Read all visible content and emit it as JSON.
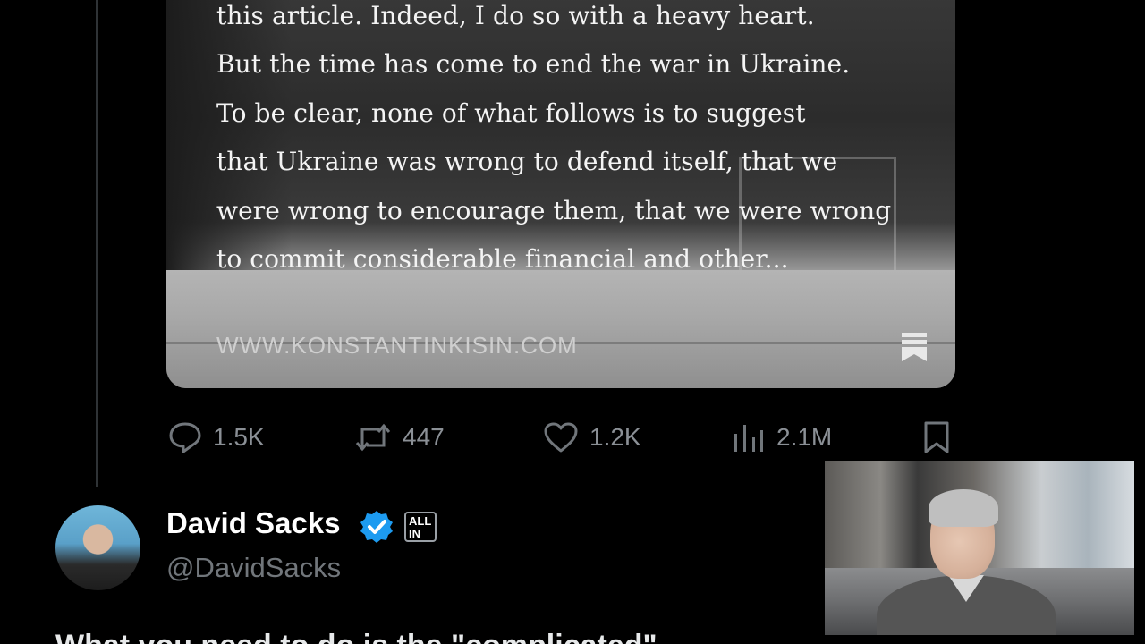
{
  "article": {
    "lines": [
      "this article. Indeed, I do so with a heavy heart.",
      "But the time has come to end the war in Ukraine.",
      "To be clear, none of what follows is to suggest",
      "that Ukraine was wrong to defend itself, that we",
      "were wrong to encourage them, that we were wrong",
      "to commit considerable financial and other..."
    ],
    "url": "WWW.KONSTANTINKISIN.COM",
    "bookmark_icon": "bookmark-ribbon-icon"
  },
  "actions": {
    "replies": "1.5K",
    "reposts": "447",
    "likes": "1.2K",
    "views": "2.1M"
  },
  "author": {
    "name": "David Sacks",
    "handle": "@DavidSacks",
    "affiliation": "ALL IN",
    "verified": true
  },
  "next_post": {
    "text": "What you need to do is the \"complicated\" ..."
  },
  "colors": {
    "background": "#000000",
    "muted": "#71767b",
    "verified_blue": "#1d9bf0"
  }
}
